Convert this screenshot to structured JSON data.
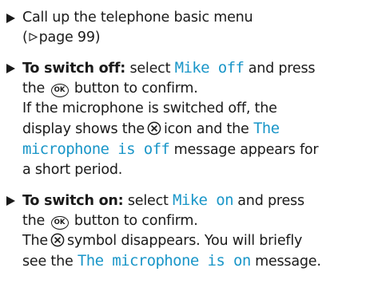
{
  "steps": [
    {
      "t1": "Call up the telephone basic menu",
      "t2": "(",
      "t3": "page 99)"
    },
    {
      "title": "To switch off:",
      "t1": "select",
      "display1": "Mike off",
      "t2": "and press",
      "t3": "the",
      "button_label": "OK",
      "t4": "button to confirm.",
      "t5": "If the microphone is switched off, the",
      "t6": "display shows the",
      "t7": "icon and the",
      "display2": "The",
      "display3": "microphone is off",
      "t8": "message appears for",
      "t9": "a short period."
    },
    {
      "title": "To switch on:",
      "t1": "select",
      "display1": "Mike on",
      "t2": "and press",
      "t3": "the",
      "button_label": "OK",
      "t4": "button to confirm.",
      "t5": "The",
      "t6": "symbol disappears. You will briefly",
      "t7": "see the",
      "display2": "The microphone is on",
      "t8": "message."
    }
  ],
  "icons": {
    "bullet": "triangle-right-icon",
    "page_ref": "page-reference-triangle-icon",
    "ok_button": "ok-button-icon",
    "microphone_off": "microphone-off-icon"
  },
  "colors": {
    "display_text": "#1a96c8",
    "body_text": "#1a1a1a"
  }
}
